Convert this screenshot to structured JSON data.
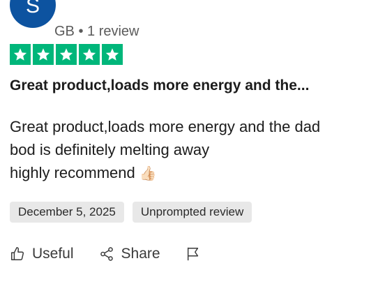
{
  "reviewer": {
    "avatar_initial": "S",
    "name": "",
    "meta": "GB • 1 review",
    "avatar_color": "#0d53a0"
  },
  "rating": {
    "stars": 5,
    "max": 5,
    "color": "#00b67a"
  },
  "review": {
    "title": "Great product,loads more energy and the...",
    "body_line_1": "Great product,loads more energy and the dad",
    "body_line_2": "bod is definitely melting away",
    "body_line_3": "highly recommend",
    "emoji": "👍🏻"
  },
  "chips": {
    "date": "December 5, 2025",
    "prompt": "Unprompted review"
  },
  "actions": {
    "useful_label": "Useful",
    "share_label": "Share",
    "useful_icon": "thumbs-up-icon",
    "share_icon": "share-icon",
    "flag_icon": "flag-icon"
  }
}
